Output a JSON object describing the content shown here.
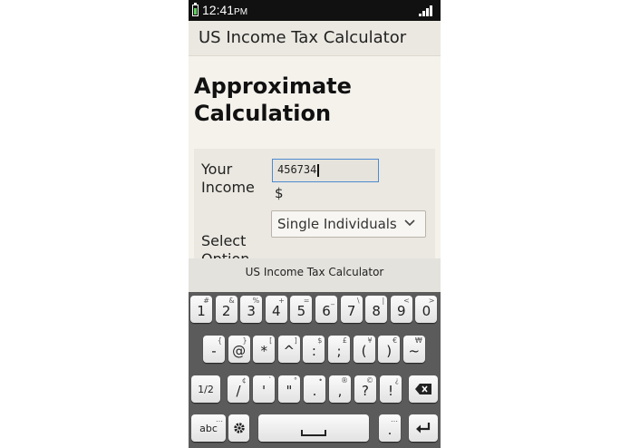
{
  "status": {
    "time": "12:41",
    "ampm": "PM"
  },
  "app": {
    "title": "US Income Tax Calculator"
  },
  "content": {
    "heading_line1": "Approximate",
    "heading_line2": "Calculation",
    "income_label_line1": "Your",
    "income_label_line2": "Income",
    "income_value": "456734",
    "currency": "$",
    "option_label_line1": "Select",
    "option_label_line2": "Option",
    "select_value": "Single Individuals"
  },
  "keyboard": {
    "title": "US Income Tax Calculator",
    "row1": [
      {
        "main": "1",
        "sub": "#"
      },
      {
        "main": "2",
        "sub": "&"
      },
      {
        "main": "3",
        "sub": "%"
      },
      {
        "main": "4",
        "sub": "+"
      },
      {
        "main": "5",
        "sub": "="
      },
      {
        "main": "6",
        "sub": "_"
      },
      {
        "main": "7",
        "sub": "\\"
      },
      {
        "main": "8",
        "sub": "|"
      },
      {
        "main": "9",
        "sub": "<"
      },
      {
        "main": "0",
        "sub": ">"
      }
    ],
    "row2": [
      {
        "main": "-",
        "sub": "{"
      },
      {
        "main": "@",
        "sub": "}"
      },
      {
        "main": "*",
        "sub": "["
      },
      {
        "main": "^",
        "sub": "]"
      },
      {
        "main": ":",
        "sub": "$"
      },
      {
        "main": ";",
        "sub": "£"
      },
      {
        "main": "(",
        "sub": "¥"
      },
      {
        "main": ")",
        "sub": "€"
      },
      {
        "main": "~",
        "sub": "₩"
      }
    ],
    "row3": [
      {
        "main": "/",
        "sub": "¢"
      },
      {
        "main": "'",
        "sub": "`"
      },
      {
        "main": "\"",
        "sub": "°"
      },
      {
        "main": ".",
        "sub": "•"
      },
      {
        "main": ",",
        "sub": "®"
      },
      {
        "main": "?",
        "sub": "©"
      },
      {
        "main": "!",
        "sub": "¿"
      }
    ],
    "shift_label": "1/2",
    "abc_label": "abc",
    "abc_sub": "…",
    "period_label": ".",
    "period_sub": "…"
  }
}
